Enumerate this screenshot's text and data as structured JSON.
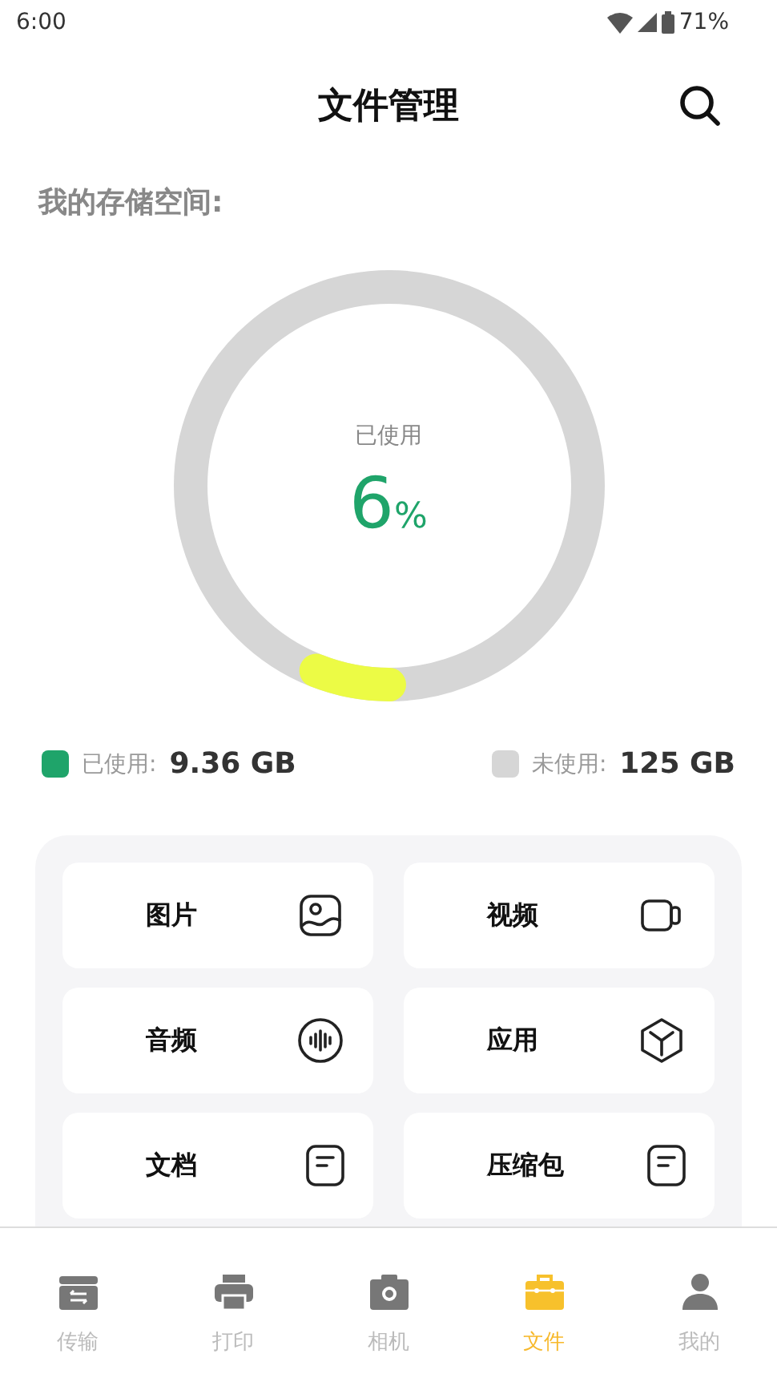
{
  "status_bar": {
    "time": "6:00",
    "battery": "71%"
  },
  "header": {
    "title": "文件管理"
  },
  "storage": {
    "label": "我的存储空间:",
    "ring": {
      "caption": "已使用",
      "value": "6",
      "unit": "%",
      "level": 0.06
    },
    "legend": [
      {
        "label": "已使用:",
        "amount": "9.36 GB",
        "color": "#1fa46a"
      },
      {
        "label": "未使用:",
        "amount": "125 GB",
        "color": "#d6d6d6"
      }
    ]
  },
  "categories": [
    {
      "label": "图片",
      "kind": "image"
    },
    {
      "label": "视频",
      "kind": "video"
    },
    {
      "label": "音频",
      "kind": "audio"
    },
    {
      "label": "应用",
      "kind": "app"
    },
    {
      "label": "文档",
      "kind": "doc"
    },
    {
      "label": "压缩包",
      "kind": "doc"
    }
  ],
  "nav": [
    {
      "label": "传输",
      "kind": "transfer",
      "selected": false
    },
    {
      "label": "打印",
      "kind": "print",
      "selected": false
    },
    {
      "label": "相机",
      "kind": "camera",
      "selected": false
    },
    {
      "label": "文件",
      "kind": "files",
      "selected": true
    },
    {
      "label": "我的",
      "kind": "user",
      "selected": false
    }
  ]
}
